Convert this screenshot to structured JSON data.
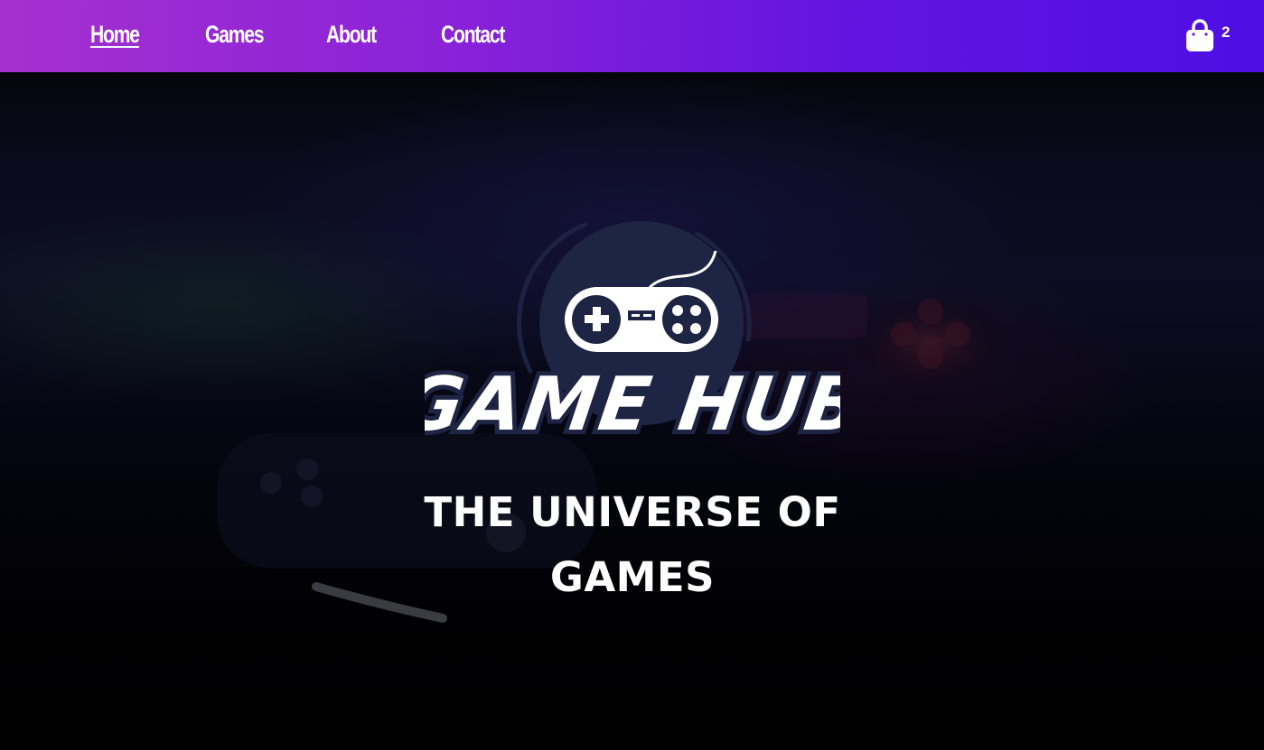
{
  "nav": {
    "links": [
      {
        "label": "Home",
        "active": true
      },
      {
        "label": "Games",
        "active": false
      },
      {
        "label": "About",
        "active": false
      },
      {
        "label": "Contact",
        "active": false
      }
    ],
    "cart": {
      "icon": "shopping-bag-icon",
      "count": "2"
    }
  },
  "hero": {
    "logo_text": "GAME HUB",
    "logo_icon": "gamepad-icon",
    "tagline": "THE UNIVERSE OF GAMES"
  },
  "colors": {
    "nav_gradient_start": "#a530cf",
    "nav_gradient_end": "#4d0ee4",
    "logo_circle": "#1e2444",
    "text": "#ffffff"
  }
}
